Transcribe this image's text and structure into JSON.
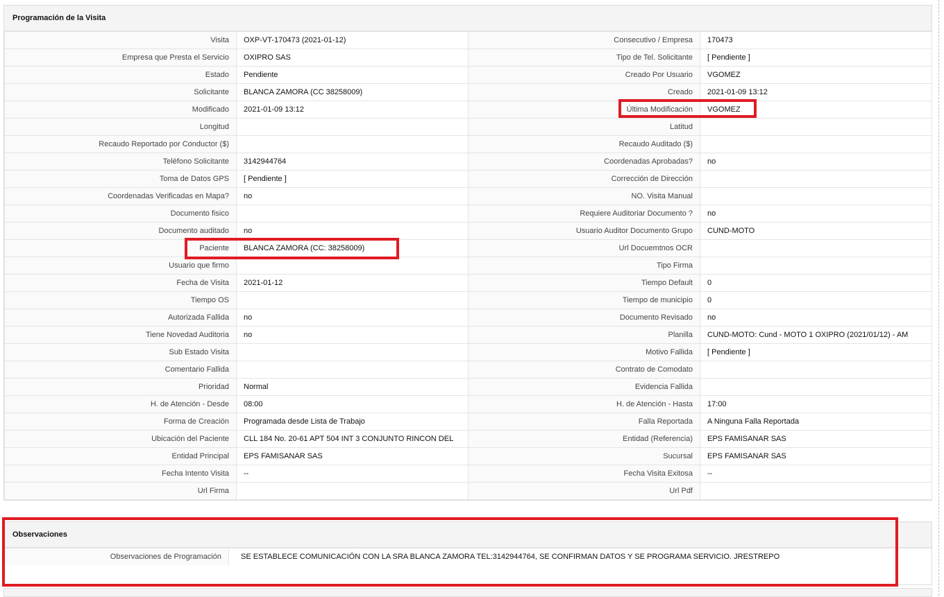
{
  "programacion": {
    "title": "Programación de la Visita",
    "rows": [
      {
        "l1": "Visita",
        "v1": "OXP-VT-170473 (2021-01-12)",
        "l2": "Consecutivo / Empresa",
        "v2": "170473"
      },
      {
        "l1": "Empresa que Presta el Servicio",
        "v1": "OXIPRO SAS",
        "l2": "Tipo de Tel. Solicitante",
        "v2": "[ Pendiente ]"
      },
      {
        "l1": "Estado",
        "v1": "Pendiente",
        "l2": "Creado Por Usuario",
        "v2": "VGOMEZ"
      },
      {
        "l1": "Solicitante",
        "v1": "BLANCA ZAMORA (CC 38258009)",
        "l2": "Creado",
        "v2": "2021-01-09 13:12"
      },
      {
        "l1": "Modificado",
        "v1": "2021-01-09 13:12",
        "l2": "Última Modificación",
        "v2": " VGOMEZ"
      },
      {
        "l1": "Longitud",
        "v1": "",
        "l2": "Latitud",
        "v2": ""
      },
      {
        "l1": "Recaudo Reportado por Conductor ($)",
        "v1": "",
        "l2": "Recaudo Auditado ($)",
        "v2": ""
      },
      {
        "l1": "Teléfono Solicitante",
        "v1": "3142944764",
        "l2": "Coordenadas Aprobadas?",
        "v2": " no"
      },
      {
        "l1": "Toma de Datos GPS",
        "v1": "[ Pendiente ]",
        "l2": "Corrección de Dirección",
        "v2": ""
      },
      {
        "l1": "Coordenadas Verificadas en Mapa?",
        "v1": " no",
        "l2": "NO. Visita Manual",
        "v2": ""
      },
      {
        "l1": "Documento fisico",
        "v1": "",
        "l2": "Requiere Auditoriar Documento ?",
        "v2": " no"
      },
      {
        "l1": "Documento auditado",
        "v1": " no",
        "l2": "Usuario Auditor Documento Grupo",
        "v2": "CUND-MOTO"
      },
      {
        "l1": "Paciente",
        "v1": "BLANCA ZAMORA (CC: 38258009)",
        "l2": "Url Docuemtnos OCR",
        "v2": ""
      },
      {
        "l1": "Usuario que firmo",
        "v1": "",
        "l2": "Tipo Firma",
        "v2": ""
      },
      {
        "l1": "Fecha de Visita",
        "v1": " 2021-01-12",
        "l2": "Tiempo Default",
        "v2": "0"
      },
      {
        "l1": "Tiempo OS",
        "v1": "",
        "l2": "Tiempo de municipio",
        "v2": "0"
      },
      {
        "l1": "Autorizada Fallida",
        "v1": " no",
        "l2": "Documento Revisado",
        "v2": " no"
      },
      {
        "l1": "Tiene Novedad Auditoria",
        "v1": " no",
        "l2": "Planilla",
        "v2": "CUND-MOTO: Cund - MOTO 1 OXIPRO (2021/01/12) - AM"
      },
      {
        "l1": "Sub Estado Visita",
        "v1": "",
        "l2": "Motivo Fallida",
        "v2": "[ Pendiente ]"
      },
      {
        "l1": "Comentario Fallida",
        "v1": "",
        "l2": "Contrato de Comodato",
        "v2": ""
      },
      {
        "l1": "Prioridad",
        "v1": "Normal",
        "l2": "Evidencia Fallida",
        "v2": ""
      },
      {
        "l1": "H. de Atención - Desde",
        "v1": "08:00",
        "l2": "H. de Atención - Hasta",
        "v2": "17:00"
      },
      {
        "l1": "Forma de Creación",
        "v1": "Programada desde Lista de Trabajo",
        "l2": "Falla Reportada",
        "v2": "A Ninguna Falla Reportada"
      },
      {
        "l1": "Ubicación del Paciente",
        "v1": "CLL 184 No. 20-61 APT 504 INT 3 CONJUNTO RINCON DEL",
        "l2": "Entidad (Referencia)",
        "v2": "EPS FAMISANAR SAS"
      },
      {
        "l1": "Entidad Principal",
        "v1": "EPS FAMISANAR SAS",
        "l2": "Sucursal",
        "v2": "EPS FAMISANAR SAS"
      },
      {
        "l1": "Fecha Intento Visita",
        "v1": " --",
        "l2": "Fecha Visita Exitosa",
        "v2": " --"
      },
      {
        "l1": "Url Firma",
        "v1": "",
        "l2": "Url Pdf",
        "v2": ""
      }
    ]
  },
  "observaciones": {
    "title": "Observaciones",
    "label": "Observaciones de Programación",
    "value": "SE ESTABLECE COMUNICACIÓN CON LA SRA BLANCA ZAMORA TEL:3142944764, SE CONFIRMAN DATOS Y SE PROGRAMA SERVICIO. JRESTREPO"
  },
  "highlight_color": "#e01b24"
}
